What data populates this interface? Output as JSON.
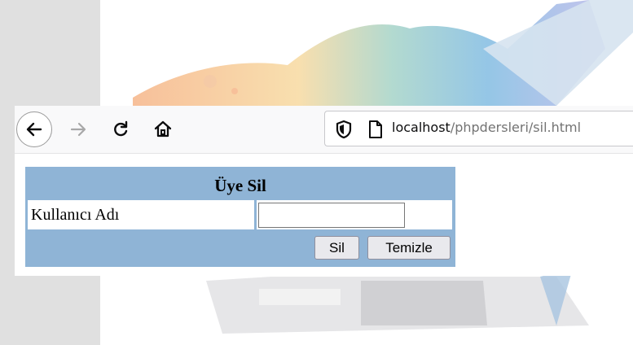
{
  "browser": {
    "nav": {
      "back_icon": "arrow-left-icon",
      "forward_icon": "arrow-right-icon",
      "reload_icon": "reload-icon",
      "home_icon": "home-icon"
    },
    "url": {
      "host": "localhost",
      "path": "/phpdersleri/sil.html"
    }
  },
  "form": {
    "title": "Üye Sil",
    "username_label": "Kullanıcı Adı",
    "username_value": "",
    "delete_button": "Sil",
    "clear_button": "Temizle"
  },
  "colors": {
    "table_bg": "#8fb4d6",
    "left_panel": "#e0e0e0"
  }
}
